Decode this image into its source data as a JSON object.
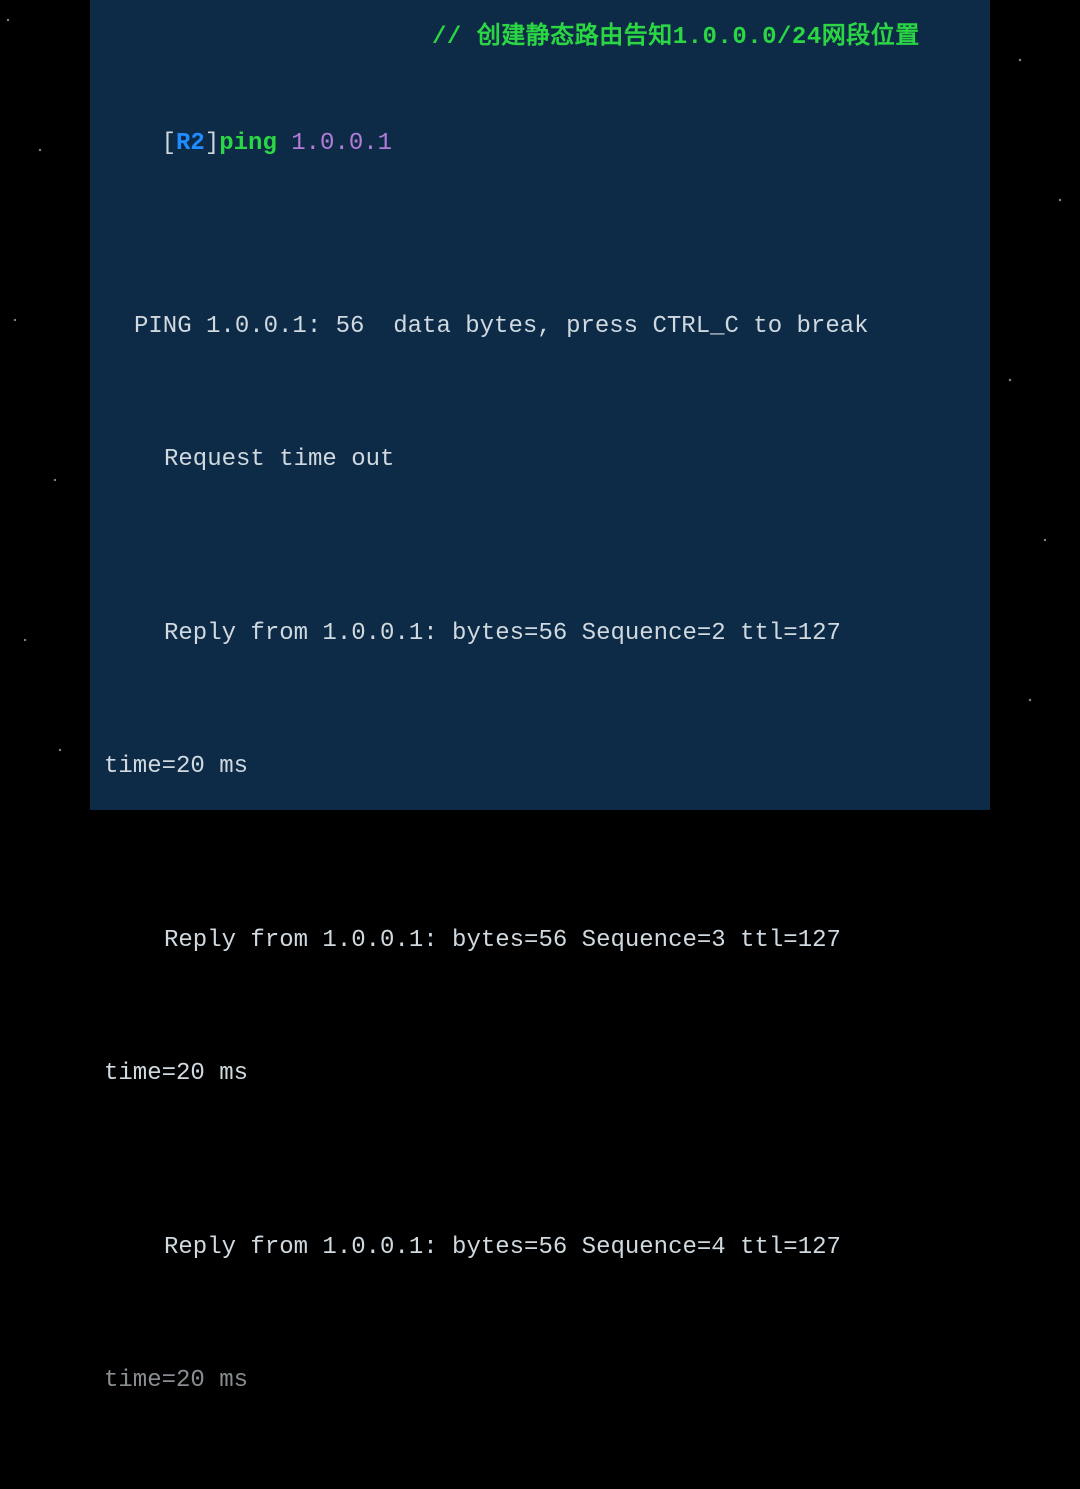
{
  "comment": "// 创建静态路由告知1.0.0.0/24网段位置",
  "prompt": {
    "open_bracket": "[",
    "router": "R2",
    "close_bracket": "]",
    "command": "ping",
    "argument": "1.0.0.1"
  },
  "output": {
    "header": "PING 1.0.0.1: 56  data bytes, press CTRL_C to break",
    "timeout": "Request time out",
    "replies": [
      {
        "head": "Reply from 1.0.0.1: bytes=56 Sequence=2 ttl=127",
        "tail": "time=20 ms"
      },
      {
        "head": "Reply from 1.0.0.1: bytes=56 Sequence=3 ttl=127",
        "tail": "time=20 ms"
      },
      {
        "head": "Reply from 1.0.0.1: bytes=56 Sequence=4 ttl=127",
        "tail": "time=20 ms"
      }
    ]
  }
}
